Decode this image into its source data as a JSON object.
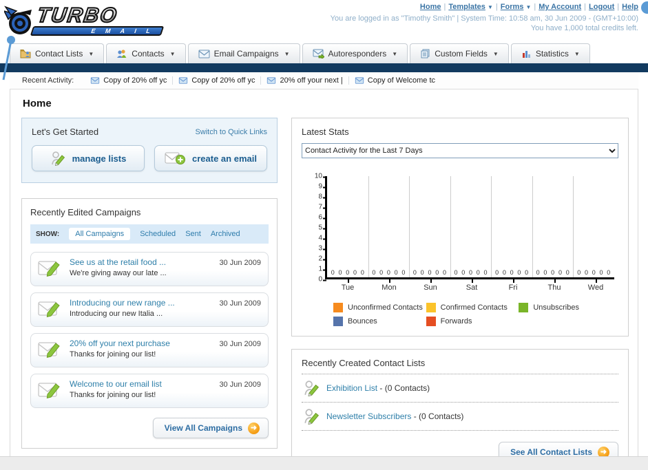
{
  "colors": {
    "accent_blue": "#3a74a5",
    "navy_bar": "#123a5f",
    "annotation_blue": "#5b9bd5",
    "link_teal": "#2e7fa9",
    "orange": "#f68b1f",
    "yellow": "#fbc32a",
    "green": "#7ab529",
    "blue": "#5674ab",
    "red": "#e54e22"
  },
  "header": {
    "logo_line1": "TURBO",
    "logo_line2": "E M A I L",
    "nav_links": [
      {
        "label": "Home",
        "dropdown": false
      },
      {
        "label": "Templates",
        "dropdown": true
      },
      {
        "label": "Forms",
        "dropdown": true
      },
      {
        "label": "My Account",
        "dropdown": false
      },
      {
        "label": "Logout",
        "dropdown": false
      },
      {
        "label": "Help",
        "dropdown": false
      }
    ],
    "login_info": "You are logged in as \"Timothy Smith\" | System Time: 10:58 am, 30 Jun 2009 - (GMT+10:00)",
    "credits_info": "You have 1,000 total credits left."
  },
  "tabs": [
    {
      "label": "Contact Lists",
      "icon": "folder-contact-icon"
    },
    {
      "label": "Contacts",
      "icon": "people-icon"
    },
    {
      "label": "Email Campaigns",
      "icon": "envelope-icon"
    },
    {
      "label": "Autoresponders",
      "icon": "envelope-arrow-icon"
    },
    {
      "label": "Custom Fields",
      "icon": "documents-icon"
    },
    {
      "label": "Statistics",
      "icon": "bar-chart-icon"
    }
  ],
  "recent_activity": {
    "label": "Recent Activity:",
    "items": [
      "Copy of 20% off yc",
      "Copy of 20% off yc",
      "20% off your next |",
      "Copy of Welcome tc"
    ]
  },
  "page_title": "Home",
  "get_started": {
    "title": "Let's Get Started",
    "switch_link": "Switch to Quick Links",
    "button1": "manage lists",
    "button2": "create an email"
  },
  "campaigns": {
    "title": "Recently Edited Campaigns",
    "show_label": "SHOW:",
    "filters": [
      "All Campaigns",
      "Scheduled",
      "Sent",
      "Archived"
    ],
    "active_filter": "All Campaigns",
    "items": [
      {
        "title": "See us at the retail food ...",
        "subtitle": "We're giving away our late ...",
        "date": "30 Jun 2009"
      },
      {
        "title": "Introducing our new range ...",
        "subtitle": "Introducing our new Italia ...",
        "date": "30 Jun 2009"
      },
      {
        "title": "20% off your next purchase",
        "subtitle": "Thanks for joining our list!",
        "date": "30 Jun 2009"
      },
      {
        "title": "Welcome to our email list",
        "subtitle": "Thanks for joining our list!",
        "date": "30 Jun 2009"
      }
    ],
    "view_all_label": "View All Campaigns"
  },
  "stats": {
    "title": "Latest Stats",
    "dropdown_value": "Contact Activity for the Last 7 Days"
  },
  "chart_data": {
    "type": "bar",
    "title": "Contact Activity for the Last 7 Days",
    "categories": [
      "Tue",
      "Mon",
      "Sun",
      "Sat",
      "Fri",
      "Thu",
      "Wed"
    ],
    "series": [
      {
        "name": "Unconfirmed Contacts",
        "color": "#f68b1f",
        "values": [
          0,
          0,
          0,
          0,
          0,
          0,
          0
        ]
      },
      {
        "name": "Confirmed Contacts",
        "color": "#fbc32a",
        "values": [
          0,
          0,
          0,
          0,
          0,
          0,
          0
        ]
      },
      {
        "name": "Unsubscribes",
        "color": "#7ab529",
        "values": [
          0,
          0,
          0,
          0,
          0,
          0,
          0
        ]
      },
      {
        "name": "Bounces",
        "color": "#5674ab",
        "values": [
          0,
          0,
          0,
          0,
          0,
          0,
          0
        ]
      },
      {
        "name": "Forwards",
        "color": "#e54e22",
        "values": [
          0,
          0,
          0,
          0,
          0,
          0,
          0
        ]
      }
    ],
    "ylim": [
      0,
      10
    ],
    "yticks": [
      0,
      1,
      2,
      3,
      4,
      5,
      6,
      7,
      8,
      9,
      10
    ],
    "grid": true,
    "legend_position": "bottom",
    "data_labels": "0"
  },
  "contact_lists": {
    "title": "Recently Created Contact Lists",
    "items": [
      {
        "name": "Exhibition List",
        "detail": "- (0 Contacts)"
      },
      {
        "name": "Newsletter Subscribers",
        "detail": "- (0 Contacts)"
      }
    ],
    "see_all_label": "See All Contact Lists"
  }
}
